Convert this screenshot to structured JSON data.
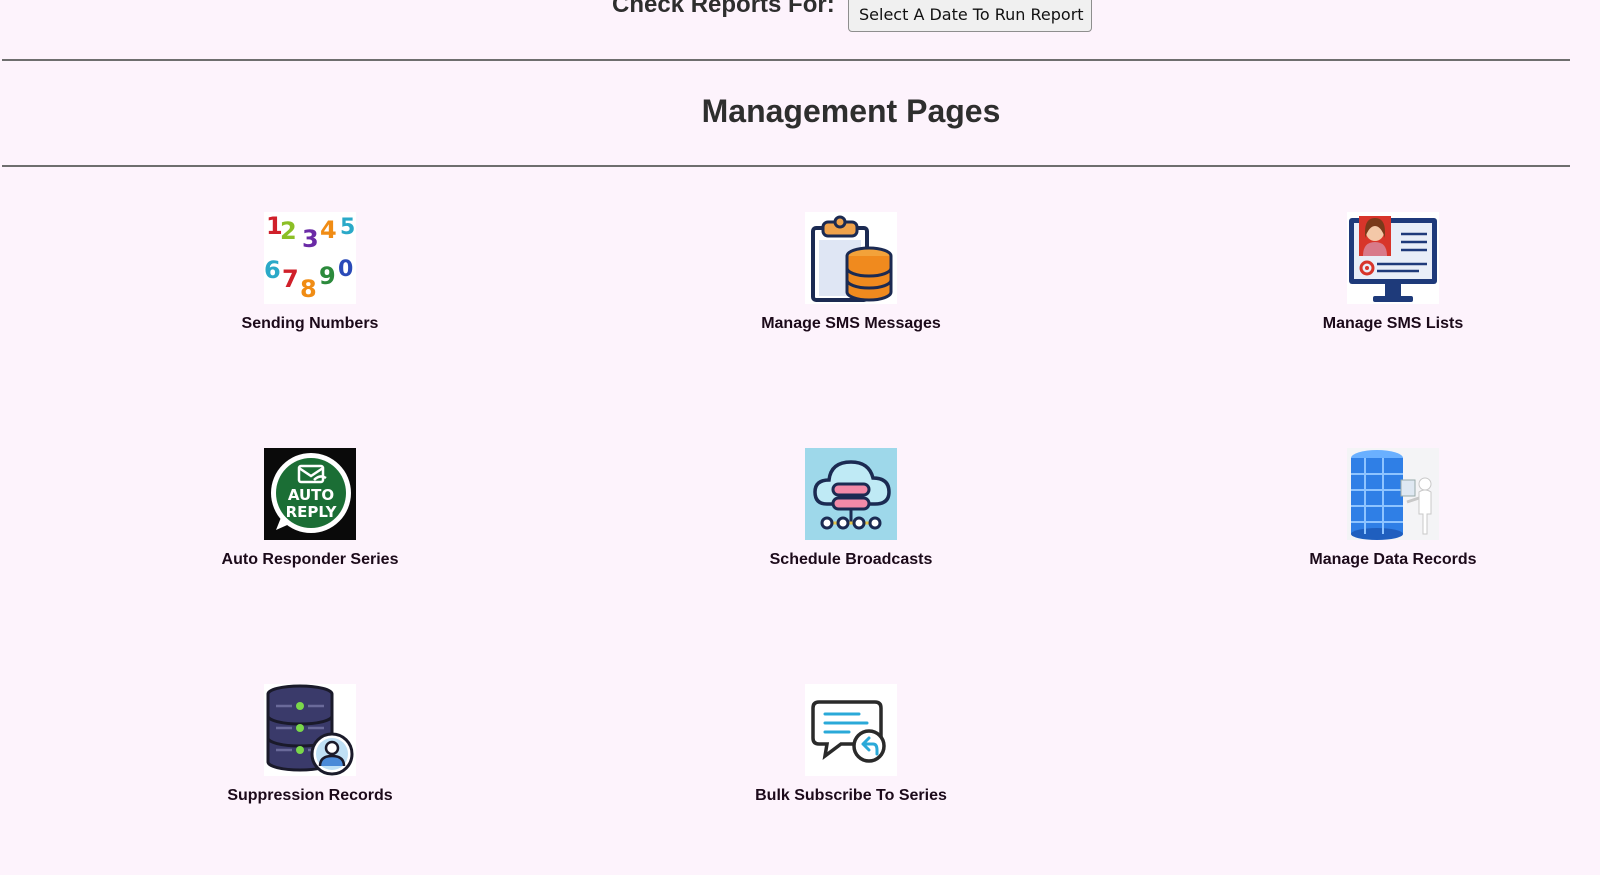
{
  "reports": {
    "label": "Check Reports For:",
    "select_value": "Select A Date To Run Report"
  },
  "section": {
    "title": "Management Pages"
  },
  "tiles": [
    {
      "label": "Sending Numbers",
      "icon": "numbers-icon"
    },
    {
      "label": "Manage SMS Messages",
      "icon": "clipboard-database-icon"
    },
    {
      "label": "Manage SMS Lists",
      "icon": "profile-monitor-icon"
    },
    {
      "label": "Auto Responder Series",
      "icon": "auto-reply-icon"
    },
    {
      "label": "Schedule Broadcasts",
      "icon": "cloud-server-icon"
    },
    {
      "label": "Manage Data Records",
      "icon": "data-server-icon"
    },
    {
      "label": "Suppression Records",
      "icon": "database-user-icon"
    },
    {
      "label": "Bulk Subscribe To Series",
      "icon": "chat-reply-icon"
    }
  ],
  "colors": {
    "background": "#fdf3fc",
    "divider": "#6e6e6e",
    "label_text": "#1c0a1a"
  }
}
